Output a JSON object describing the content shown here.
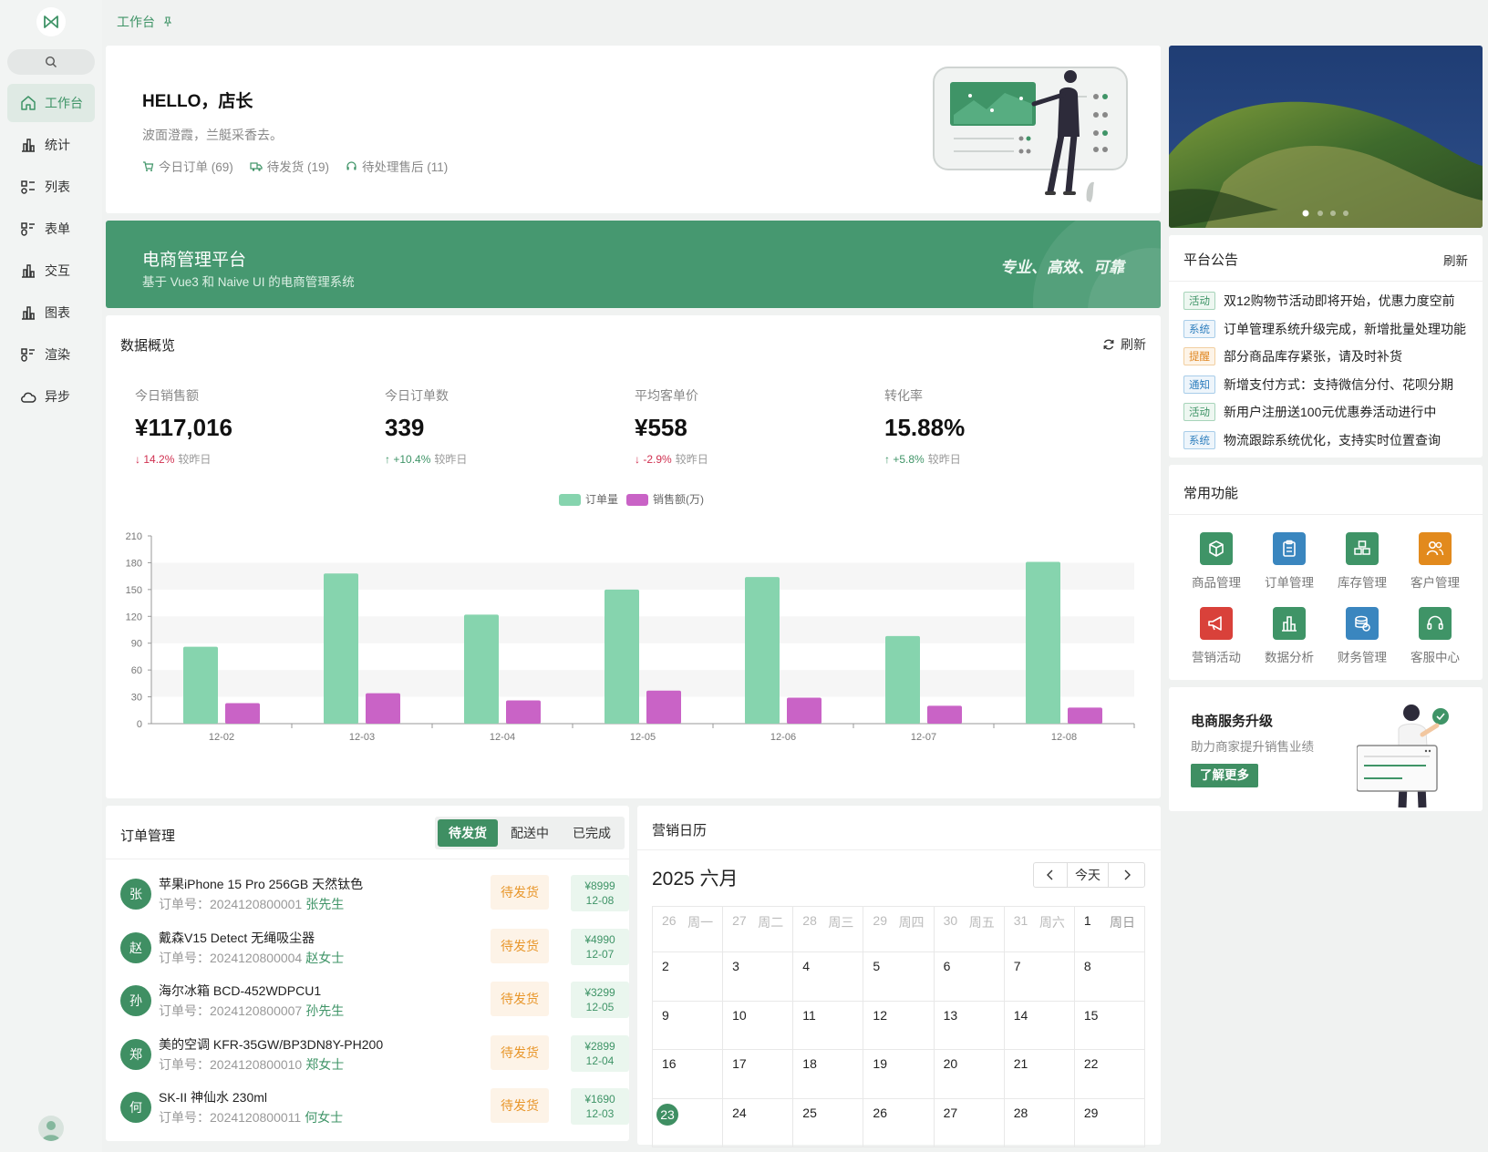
{
  "sidebar": {
    "items": [
      {
        "label": "工作台",
        "icon": "home-icon"
      },
      {
        "label": "统计",
        "icon": "bar-chart-icon"
      },
      {
        "label": "列表",
        "icon": "list-icon"
      },
      {
        "label": "表单",
        "icon": "form-icon"
      },
      {
        "label": "交互",
        "icon": "bar-chart-icon"
      },
      {
        "label": "图表",
        "icon": "bar-chart-icon"
      },
      {
        "label": "渲染",
        "icon": "form-icon"
      },
      {
        "label": "异步",
        "icon": "cloud-icon"
      }
    ]
  },
  "breadcrumb": {
    "current": "工作台"
  },
  "hello": {
    "title": "HELLO，店长",
    "subtitle": "波面澄霞，兰艇采香去。",
    "stats": [
      {
        "label": "今日订单 (69)"
      },
      {
        "label": "待发货 (19)"
      },
      {
        "label": "待处理售后 (11)"
      }
    ]
  },
  "banner": {
    "title": "电商管理平台",
    "subtitle": "基于 Vue3 和 Naive UI 的电商管理系统",
    "slogan": "专业、高效、可靠"
  },
  "overview": {
    "title": "数据概览",
    "refresh_label": "刷新",
    "stats": [
      {
        "label": "今日销售额",
        "value": "¥117,016",
        "delta": "14.2%",
        "compare": "较昨日",
        "direction": "down"
      },
      {
        "label": "今日订单数",
        "value": "339",
        "delta": "+10.4%",
        "compare": "较昨日",
        "direction": "up"
      },
      {
        "label": "平均客单价",
        "value": "¥558",
        "delta": "-2.9%",
        "compare": "较昨日",
        "direction": "down"
      },
      {
        "label": "转化率",
        "value": "15.88%",
        "delta": "+5.8%",
        "compare": "较昨日",
        "direction": "up"
      }
    ]
  },
  "chart_data": {
    "type": "bar",
    "categories": [
      "12-02",
      "12-03",
      "12-04",
      "12-05",
      "12-06",
      "12-07",
      "12-08"
    ],
    "series": [
      {
        "name": "订单量",
        "values": [
          86,
          168,
          122,
          150,
          164,
          98,
          181
        ],
        "color": "#86d4ae"
      },
      {
        "name": "销售额(万)",
        "values": [
          23,
          34,
          26,
          37,
          29,
          20,
          18
        ],
        "color": "#c963c6"
      }
    ],
    "ylim": [
      0,
      210
    ],
    "yticks": [
      0,
      30,
      60,
      90,
      120,
      150,
      180,
      210
    ],
    "legend_position": "top-center",
    "grid": true
  },
  "notice": {
    "title": "平台公告",
    "refresh_label": "刷新",
    "items": [
      {
        "tag": "活动",
        "tag_color": "green",
        "text": "双12购物节活动即将开始，优惠力度空前"
      },
      {
        "tag": "系统",
        "tag_color": "blue",
        "text": "订单管理系统升级完成，新增批量处理功能"
      },
      {
        "tag": "提醒",
        "tag_color": "orange",
        "text": "部分商品库存紧张，请及时补货"
      },
      {
        "tag": "通知",
        "tag_color": "blue",
        "text": "新增支付方式：支持微信分付、花呗分期"
      },
      {
        "tag": "活动",
        "tag_color": "green",
        "text": "新用户注册送100元优惠券活动进行中"
      },
      {
        "tag": "系统",
        "tag_color": "blue",
        "text": "物流跟踪系统优化，支持实时位置查询"
      }
    ]
  },
  "functions": {
    "title": "常用功能",
    "items": [
      {
        "label": "商品管理",
        "icon": "box-icon",
        "color": "#3f9467"
      },
      {
        "label": "订单管理",
        "icon": "clipboard-icon",
        "color": "#3a86bf"
      },
      {
        "label": "库存管理",
        "icon": "stack-icon",
        "color": "#3f9467"
      },
      {
        "label": "客户管理",
        "icon": "users-icon",
        "color": "#e28a1d"
      },
      {
        "label": "营销活动",
        "icon": "megaphone-icon",
        "color": "#d9413a"
      },
      {
        "label": "数据分析",
        "icon": "bar-chart-icon",
        "color": "#3f9467"
      },
      {
        "label": "财务管理",
        "icon": "coins-icon",
        "color": "#3a86bf"
      },
      {
        "label": "客服中心",
        "icon": "headset-icon",
        "color": "#3f9467"
      }
    ]
  },
  "upgrade": {
    "title": "电商服务升级",
    "subtitle": "助力商家提升销售业绩",
    "button": "了解更多"
  },
  "orders": {
    "title": "订单管理",
    "tabs": [
      {
        "label": "待发货",
        "active": true
      },
      {
        "label": "配送中",
        "active": false
      },
      {
        "label": "已完成",
        "active": false
      }
    ],
    "order_prefix": "订单号：",
    "items": [
      {
        "avatar": "张",
        "name": "苹果iPhone 15 Pro 256GB 天然钛色",
        "order_no": "2024120800001",
        "customer": "张先生",
        "status": "待发货",
        "price": "¥8999",
        "date": "12-08"
      },
      {
        "avatar": "赵",
        "name": "戴森V15 Detect 无绳吸尘器",
        "order_no": "2024120800004",
        "customer": "赵女士",
        "status": "待发货",
        "price": "¥4990",
        "date": "12-07"
      },
      {
        "avatar": "孙",
        "name": "海尔冰箱 BCD-452WDPCU1",
        "order_no": "2024120800007",
        "customer": "孙先生",
        "status": "待发货",
        "price": "¥3299",
        "date": "12-05"
      },
      {
        "avatar": "郑",
        "name": "美的空调 KFR-35GW/BP3DN8Y-PH200",
        "order_no": "2024120800010",
        "customer": "郑女士",
        "status": "待发货",
        "price": "¥2899",
        "date": "12-04"
      },
      {
        "avatar": "何",
        "name": "SK-II 神仙水 230ml",
        "order_no": "2024120800011",
        "customer": "何女士",
        "status": "待发货",
        "price": "¥1690",
        "date": "12-03"
      }
    ]
  },
  "calendar": {
    "title": "营销日历",
    "month_label": "2025 六月",
    "today_label": "今天",
    "weekdays": [
      "周一",
      "周二",
      "周三",
      "周四",
      "周五",
      "周六",
      "周日"
    ],
    "header_days": [
      "26",
      "27",
      "28",
      "29",
      "30",
      "31",
      "1"
    ],
    "weeks": [
      [
        "2",
        "3",
        "4",
        "5",
        "6",
        "7",
        "8"
      ],
      [
        "9",
        "10",
        "11",
        "12",
        "13",
        "14",
        "15"
      ],
      [
        "16",
        "17",
        "18",
        "19",
        "20",
        "21",
        "22"
      ],
      [
        "23",
        "24",
        "25",
        "26",
        "27",
        "28",
        "29"
      ]
    ],
    "today": "23"
  }
}
